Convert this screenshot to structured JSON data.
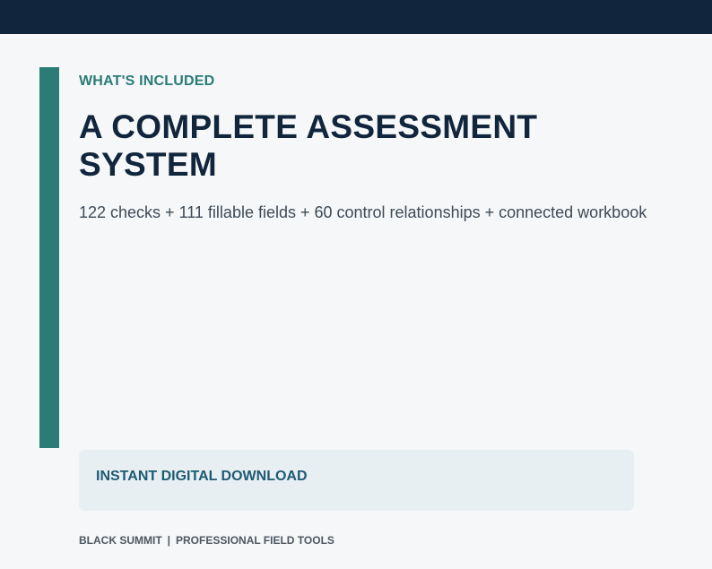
{
  "header": {},
  "section": {
    "eyebrow": "WHAT'S INCLUDED",
    "headline": "A COMPLETE ASSESSMENT SYSTEM",
    "subline": "122 checks + 111 fillable fields + 60 control relationships + connected workbook"
  },
  "download": {
    "label": "INSTANT DIGITAL DOWNLOAD"
  },
  "footer": {
    "brand": "BLACK SUMMIT",
    "separator": "|",
    "tagline": "PROFESSIONAL FIELD TOOLS"
  },
  "colors": {
    "top_bar": "#11263c",
    "accent": "#2b7b76",
    "headline": "#11263c",
    "download_text": "#1e5a73",
    "download_bg": "#e8eff3",
    "background": "#f5f7f9"
  }
}
